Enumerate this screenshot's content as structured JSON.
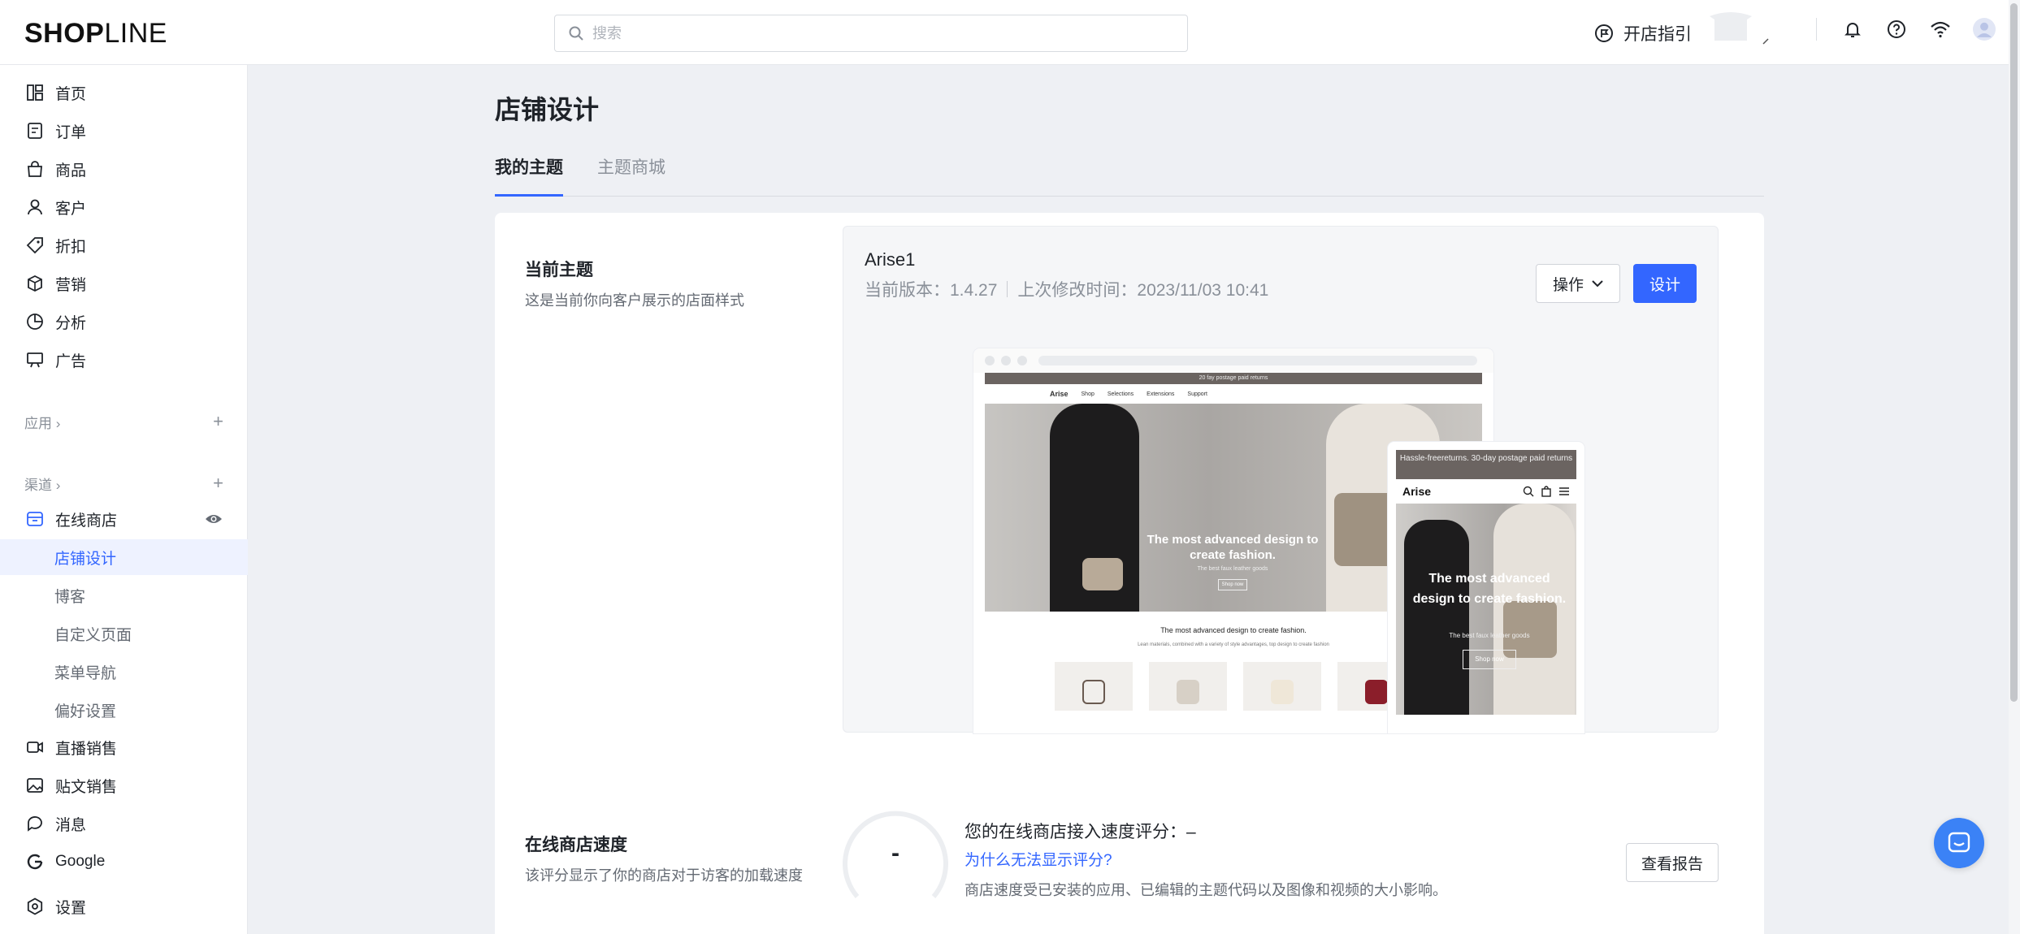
{
  "app": {
    "logo_text_bold": "SHOP",
    "logo_text_light": "LINE"
  },
  "topbar": {
    "search_placeholder": "搜索",
    "guide_label": "开店指引",
    "icons": [
      "bell-icon",
      "help-icon",
      "wifi-icon",
      "avatar-icon"
    ]
  },
  "sidebar": {
    "items": [
      {
        "label": "首页",
        "icon": "home-icon"
      },
      {
        "label": "订单",
        "icon": "order-icon"
      },
      {
        "label": "商品",
        "icon": "bag-icon"
      },
      {
        "label": "客户",
        "icon": "user-icon"
      },
      {
        "label": "折扣",
        "icon": "tag-icon"
      },
      {
        "label": "营销",
        "icon": "cube-icon"
      },
      {
        "label": "分析",
        "icon": "pie-icon"
      },
      {
        "label": "广告",
        "icon": "ad-icon"
      }
    ],
    "apps_section": "应用",
    "channels_section": "渠道",
    "online_store": "在线商店",
    "sub_items": [
      "店铺设计",
      "博客",
      "自定义页面",
      "菜单导航",
      "偏好设置"
    ],
    "channels": [
      {
        "label": "直播销售",
        "icon": "video-icon"
      },
      {
        "label": "贴文销售",
        "icon": "image-icon"
      },
      {
        "label": "消息",
        "icon": "message-icon"
      },
      {
        "label": "Google",
        "icon": "google-icon"
      }
    ],
    "settings": "设置"
  },
  "main": {
    "title": "店铺设计",
    "tabs": [
      "我的主题",
      "主题商城"
    ],
    "current_theme": {
      "title": "当前主题",
      "desc": "这是当前你向客户展示的店面样式",
      "name": "Arise1",
      "version": "当前版本：1.4.27",
      "modified": "上次修改时间：2023/11/03 10:41",
      "ops_label": "操作",
      "design_label": "设计"
    },
    "preview": {
      "promo": "20 fay postage paid returns",
      "brand": "Arise",
      "nav": [
        "Shop",
        "Selections",
        "Extensions",
        "Support"
      ],
      "hero_title": "The most advanced design to create fashion.",
      "hero_sub": "The best faux leather goods",
      "hero_btn": "Shop now",
      "caption": "The most advanced design to create fashion.",
      "caption2": "Lean materials, combined with a variety of style advantages, top design to create fashion",
      "mobile_promo": "Hassle-freereturns. 30-day postage paid returns",
      "mobile_sub": "The best faux leather goods"
    },
    "speed": {
      "title": "在线商店速度",
      "desc": "该评分显示了你的商店对于访客的加载速度",
      "score": "-",
      "score_title": "您的在线商店接入速度评分：–",
      "why_link": "为什么无法显示评分?",
      "note": "商店速度受已安装的应用、已编辑的主题代码以及图像和视频的大小影响。",
      "report_label": "查看报告"
    }
  },
  "colors": {
    "accent": "#3366ff",
    "sidebar_active_bg": "#eef2ff",
    "page_bg": "#eef0f4"
  }
}
